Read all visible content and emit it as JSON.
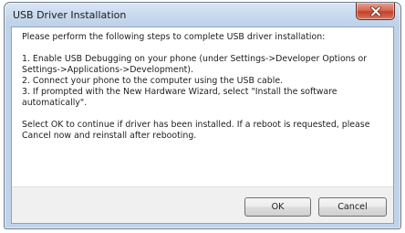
{
  "window": {
    "title": "USB Driver Installation"
  },
  "message": {
    "intro": "Please perform the following steps to complete USB driver installation:",
    "step1_line1": "1. Enable USB Debugging on your phone (under Settings->Developer Options or",
    "step1_line2": "Settings->Applications->Development).",
    "step2": "2. Connect your phone to the computer using the USB cable.",
    "step3_line1": "3. If prompted with the New Hardware Wizard, select \"Install the software",
    "step3_line2": "automatically\".",
    "outro_line1": "Select OK to continue if driver has been installed. If a reboot is requested, please",
    "outro_line2": "Cancel now and reinstall after rebooting."
  },
  "buttons": {
    "ok_label": "OK",
    "cancel_label": "Cancel"
  },
  "icons": {
    "close": "close-icon"
  },
  "colors": {
    "close_button": "#c4412b",
    "title_bar": "#bfd3ea"
  }
}
